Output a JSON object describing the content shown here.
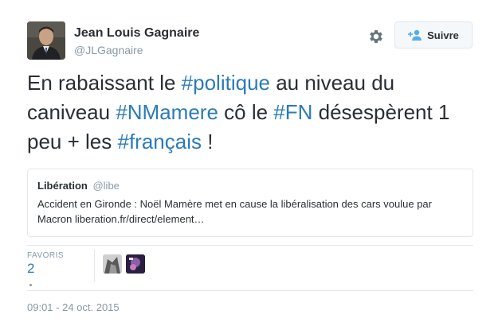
{
  "author": {
    "name": "Jean Louis Gagnaire",
    "handle": "@JLGagnaire"
  },
  "actions": {
    "follow_label": "Suivre",
    "settings_icon": "gear-icon",
    "follow_icon": "add-person-icon"
  },
  "tweet": {
    "segments": [
      {
        "text": "En rabaissant le ",
        "type": "text"
      },
      {
        "text": "#politique",
        "type": "hashtag"
      },
      {
        "text": " au niveau du caniveau ",
        "type": "text"
      },
      {
        "text": "#NMamere",
        "type": "hashtag"
      },
      {
        "text": " cô le ",
        "type": "text"
      },
      {
        "text": "#FN",
        "type": "hashtag"
      },
      {
        "text": " désespèrent 1 peu + les ",
        "type": "text"
      },
      {
        "text": "#français",
        "type": "hashtag"
      },
      {
        "text": " !",
        "type": "text"
      }
    ]
  },
  "quoted": {
    "name": "Libération",
    "handle": "@libe",
    "text": "Accident en Gironde : Noël Mamère met en cause la libéralisation des cars voulue par Macron liberation.fr/direct/element…"
  },
  "stats": {
    "label": "FAVORIS",
    "count": "2"
  },
  "timestamp": "09:01 - 24 oct. 2015",
  "colors": {
    "link": "#2b7bb9",
    "muted": "#8899a6",
    "text": "#292f33",
    "border": "#e1e8ed"
  }
}
